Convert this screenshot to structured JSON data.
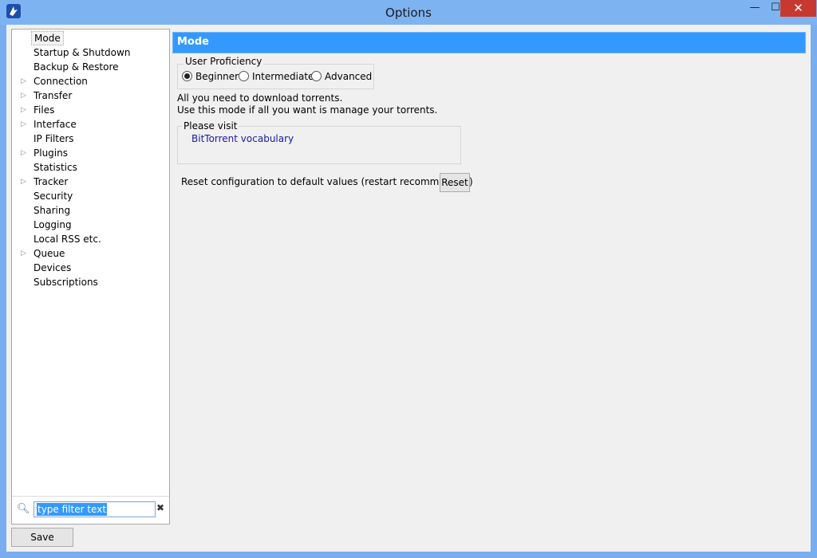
{
  "window": {
    "title": "Options",
    "minimize": "—",
    "maximize": "☐",
    "close": "✕"
  },
  "sidebar": {
    "items": [
      {
        "label": "Mode",
        "expandable": false,
        "selected": true
      },
      {
        "label": "Startup & Shutdown",
        "expandable": false
      },
      {
        "label": "Backup & Restore",
        "expandable": false
      },
      {
        "label": "Connection",
        "expandable": true
      },
      {
        "label": "Transfer",
        "expandable": true
      },
      {
        "label": "Files",
        "expandable": true
      },
      {
        "label": "Interface",
        "expandable": true
      },
      {
        "label": "IP Filters",
        "expandable": false
      },
      {
        "label": "Plugins",
        "expandable": true
      },
      {
        "label": "Statistics",
        "expandable": false
      },
      {
        "label": "Tracker",
        "expandable": true
      },
      {
        "label": "Security",
        "expandable": false
      },
      {
        "label": "Sharing",
        "expandable": false
      },
      {
        "label": "Logging",
        "expandable": false
      },
      {
        "label": "Local RSS etc.",
        "expandable": false
      },
      {
        "label": "Queue",
        "expandable": true
      },
      {
        "label": "Devices",
        "expandable": false
      },
      {
        "label": "Subscriptions",
        "expandable": false
      }
    ],
    "filter": {
      "placeholder": "type filter text",
      "icon": "search-icon",
      "clear_icon": "clear-icon"
    }
  },
  "footer": {
    "save_label": "Save"
  },
  "main": {
    "section_title": "Mode",
    "proficiency": {
      "legend": "User Proficiency",
      "options": [
        "Beginner",
        "Intermediate",
        "Advanced"
      ],
      "selected": "Beginner"
    },
    "description": [
      "All you need to download torrents.",
      "Use this mode if all you want is manage your torrents."
    ],
    "visit": {
      "legend": "Please visit",
      "link": "BitTorrent vocabulary"
    },
    "reset": {
      "label": "Reset configuration to default values (restart recommended)",
      "button": "Reset"
    }
  }
}
